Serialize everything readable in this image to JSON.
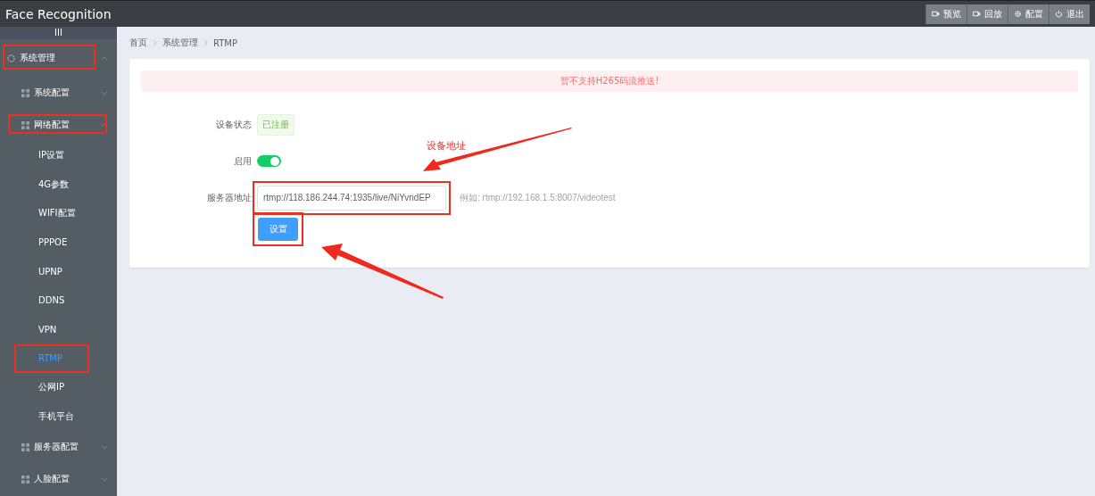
{
  "header": {
    "title": "Face Recognition",
    "buttons": [
      {
        "label": "预览",
        "kind": "camera"
      },
      {
        "label": "回放",
        "kind": "camera"
      },
      {
        "label": "配置",
        "kind": "gear"
      },
      {
        "label": "退出",
        "kind": "power"
      }
    ]
  },
  "sidebar": {
    "toggle": "III",
    "items": [
      {
        "label": "系统管理",
        "kind": "circle",
        "expanded": true,
        "highlighted": true,
        "children": [
          {
            "label": "系统配置",
            "kind": "grid",
            "expanded": false,
            "highlighted": false
          },
          {
            "label": "网络配置",
            "kind": "grid",
            "expanded": true,
            "highlighted": true,
            "children": [
              {
                "label": "IP设置",
                "selected": false,
                "highlighted": false
              },
              {
                "label": "4G参数",
                "selected": false,
                "highlighted": false
              },
              {
                "label": "WIFI配置",
                "selected": false,
                "highlighted": false
              },
              {
                "label": "PPPOE",
                "selected": false,
                "highlighted": false
              },
              {
                "label": "UPNP",
                "selected": false,
                "highlighted": false
              },
              {
                "label": "DDNS",
                "selected": false,
                "highlighted": false
              },
              {
                "label": "VPN",
                "selected": false,
                "highlighted": false
              },
              {
                "label": "RTMP",
                "selected": true,
                "highlighted": true
              },
              {
                "label": "公网IP",
                "selected": false,
                "highlighted": false
              },
              {
                "label": "手机平台",
                "selected": false,
                "highlighted": false
              }
            ]
          },
          {
            "label": "服务器配置",
            "kind": "grid",
            "expanded": false,
            "highlighted": false
          },
          {
            "label": "人脸配置",
            "kind": "grid",
            "expanded": false,
            "highlighted": false
          }
        ]
      }
    ]
  },
  "breadcrumb": [
    "首页",
    "系统管理",
    "RTMP"
  ],
  "alert": "暂不支持H265码流推送!",
  "form": {
    "status": {
      "label": "设备状态",
      "value": "已注册"
    },
    "enable": {
      "label": "启用",
      "on": true
    },
    "server": {
      "label": "服务器地址",
      "value": "rtmp://118.186.244.74:1935/live/NiYvndEP",
      "hint": "例如: rtmp://192.168.1.5:8007/videotest",
      "highlighted": true
    },
    "submit": {
      "label": "设置",
      "highlighted": true
    }
  },
  "annotation": {
    "text": "设备地址"
  }
}
